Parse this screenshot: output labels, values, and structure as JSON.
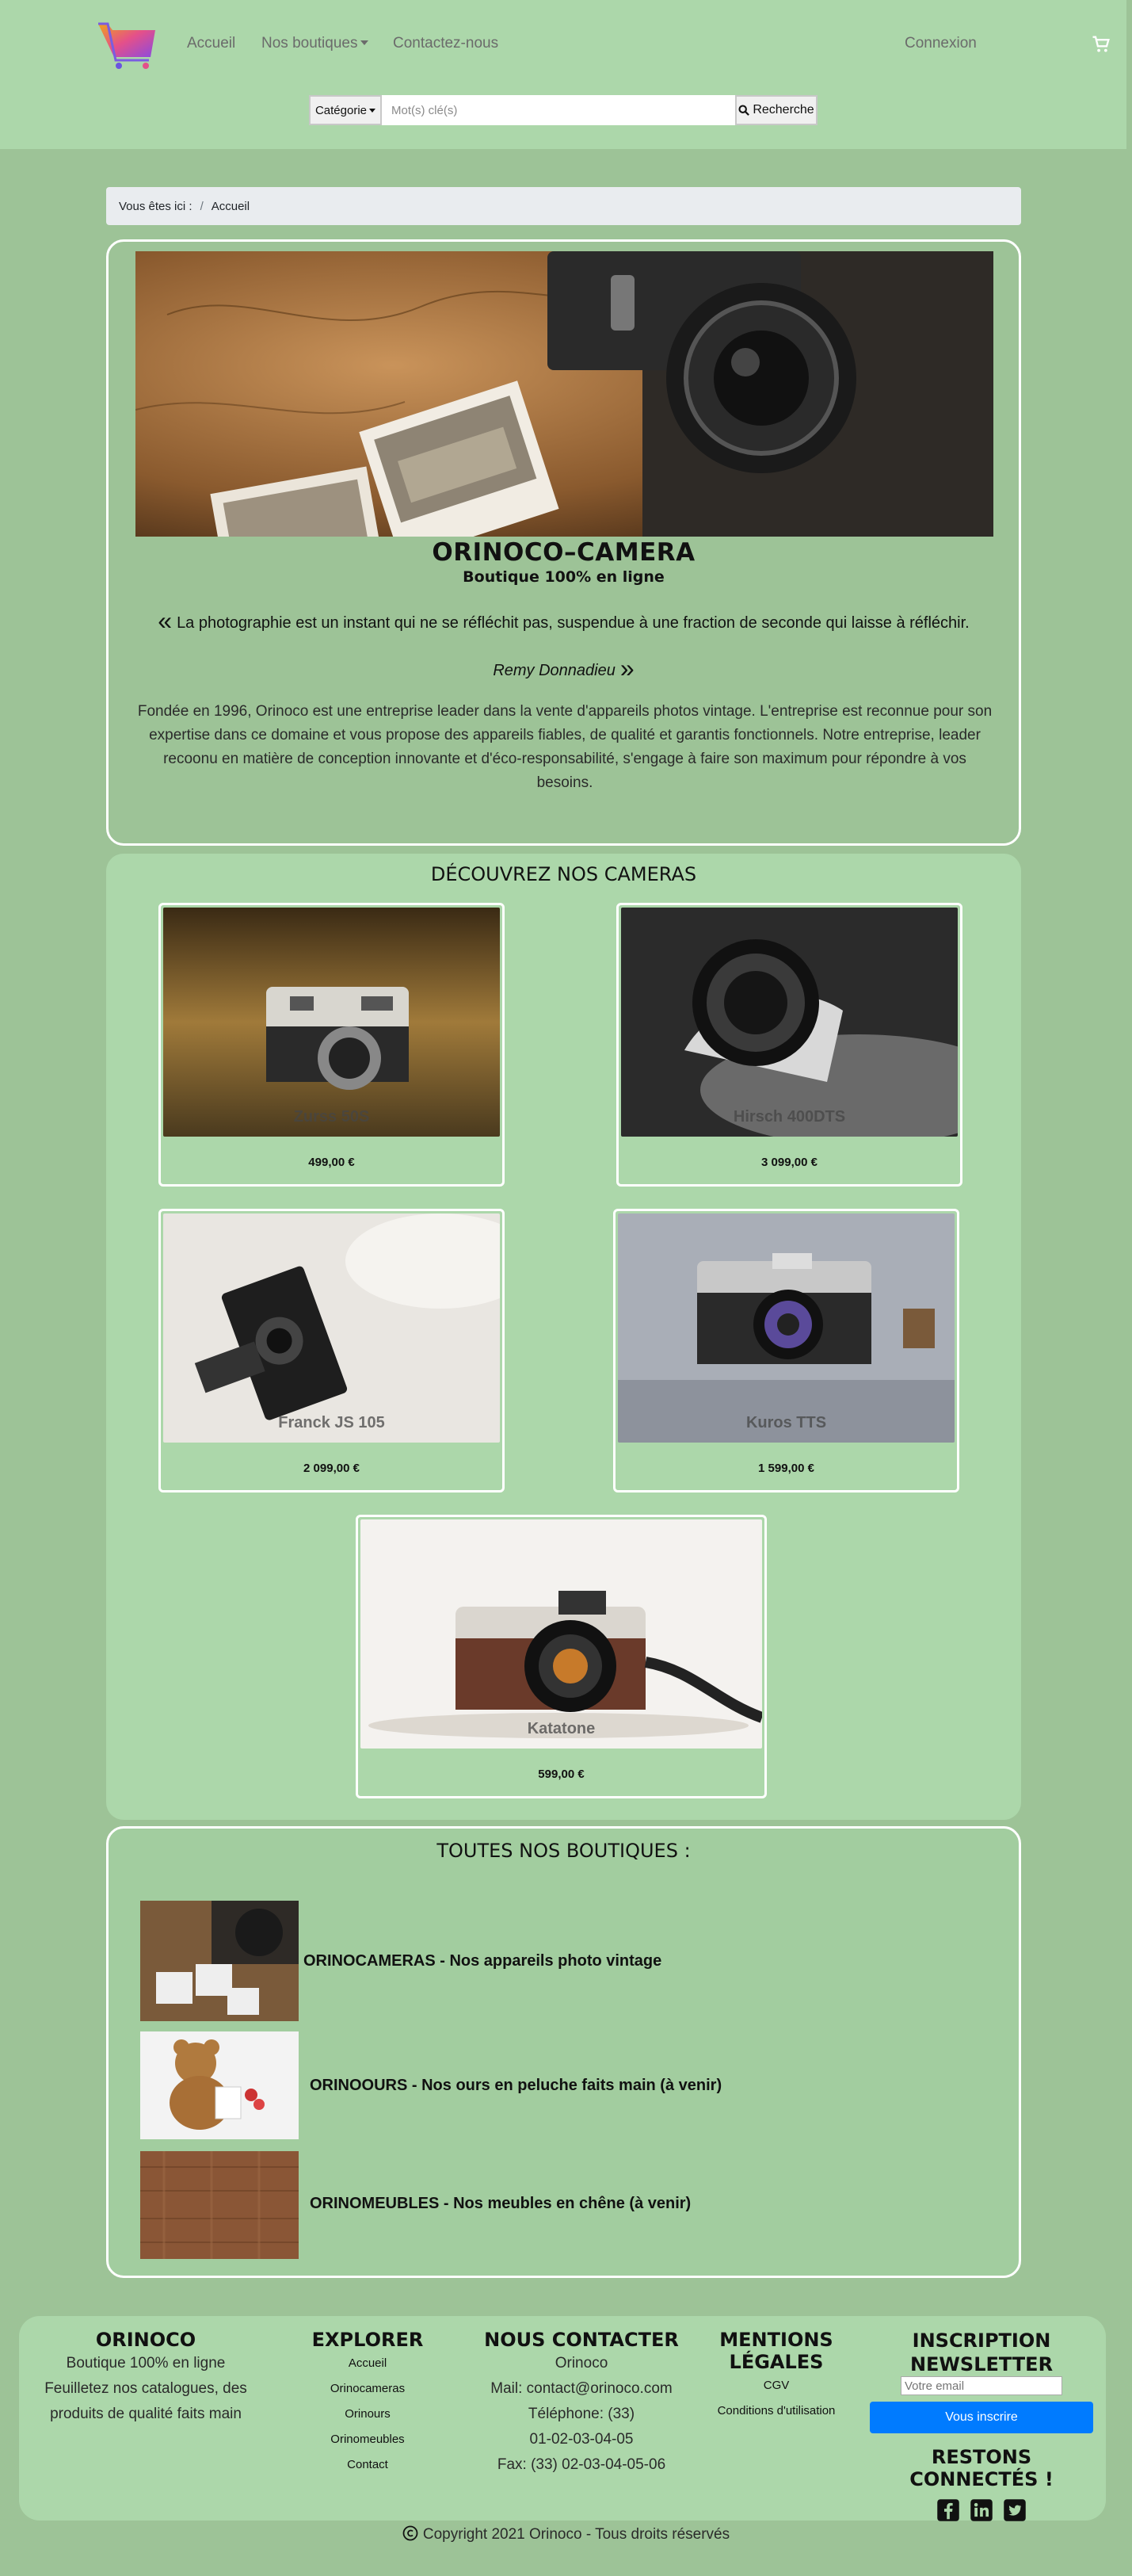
{
  "nav": {
    "links": [
      "Accueil",
      "Nos boutiques",
      "Contactez-nous"
    ],
    "login": "Connexion"
  },
  "search": {
    "category_label": "Catégorie",
    "placeholder": "Mot(s) clé(s)",
    "button_label": "Recherche"
  },
  "breadcrumb": {
    "prefix": "Vous êtes ici :",
    "separator": "/",
    "current": "Accueil"
  },
  "hero": {
    "title": "ORINOCO–CAMERA",
    "subtitle": "Boutique 100% en ligne",
    "quote": "La photographie est un instant qui ne se réfléchit pas, suspendue à une fraction de seconde qui laisse à réfléchir.",
    "author": "Remy Donnadieu",
    "about": "Fondée en 1996, Orinoco est une entreprise leader dans la vente d'appareils photos vintage. L'entreprise est reconnue pour son expertise dans ce domaine et vous propose des appareils fiables, de qualité et garantis fonctionnels. Notre entreprise, leader recoonu en matière de conception innovante et d'éco-responsabilité, s'engage à faire son maximum pour répondre à vos besoins."
  },
  "cameras": {
    "title": "DÉCOUVREZ NOS CAMERAS",
    "items": [
      {
        "name": "Zurss 50S",
        "price": "499,00 €"
      },
      {
        "name": "Hirsch 400DTS",
        "price": "3 099,00 €"
      },
      {
        "name": "Franck JS 105",
        "price": "2 099,00 €"
      },
      {
        "name": "Kuros TTS",
        "price": "1 599,00 €"
      },
      {
        "name": "Katatone",
        "price": "599,00 €"
      }
    ]
  },
  "shops": {
    "title": "TOUTES NOS BOUTIQUES :",
    "items": [
      "ORINOCAMERAS - Nos appareils photo vintage",
      "ORINOOURS - Nos ours en peluche faits main (à venir)",
      "ORINOMEUBLES - Nos meubles en chêne (à venir)"
    ]
  },
  "footer": {
    "about": {
      "title": "ORINOCO",
      "lines": [
        "Boutique 100% en ligne",
        "Feuilletez nos catalogues, des produits de qualité faits main"
      ]
    },
    "explore": {
      "title": "EXPLORER",
      "links": [
        "Accueil",
        "Orinocameras",
        "Orinours",
        "Orinomeubles",
        "Contact"
      ]
    },
    "contact": {
      "title": "NOUS CONTACTER",
      "lines": [
        "Orinoco",
        "Mail: contact@orinoco.com",
        "Téléphone: (33) 01-02-03-04-05",
        "Fax: (33) 02-03-04-05-06"
      ]
    },
    "legal": {
      "title": "MENTIONS LÉGALES",
      "links": [
        "CGV",
        "Conditions d'utilisation"
      ]
    },
    "newsletter": {
      "title": "INSCRIPTION NEWSLETTER",
      "placeholder": "Votre email",
      "button": "Vous inscrire",
      "social_title": "RESTONS CONNECTÉS !"
    },
    "copyright": "Copyright 2021 Orinoco - Tous droits réservés"
  },
  "colors": {
    "page_bg": "#9dc397",
    "nav_bg": "#acd7aa",
    "accent_button": "#007bff"
  },
  "icons": [
    "cart-logo-icon",
    "cart-icon",
    "search-icon",
    "quote-open-icon",
    "quote-close-icon",
    "facebook-icon",
    "linkedin-icon",
    "twitter-icon",
    "copyright-icon"
  ]
}
